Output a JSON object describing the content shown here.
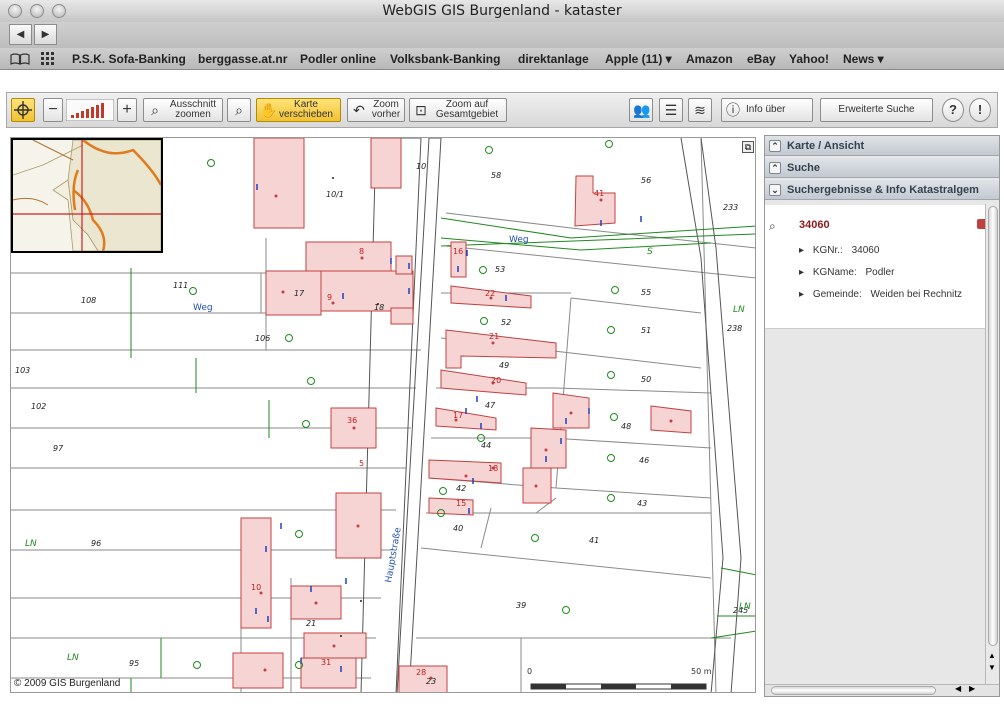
{
  "window": {
    "title": "WebGIS GIS Burgenland - kataster"
  },
  "nav": {
    "back_icon": "◀",
    "forward_icon": "▶"
  },
  "bookmarks": [
    "P.S.K. Sofa-Banking",
    "berggasse.at.nr",
    "Podler online",
    "Volksbank-Banking",
    "direktanlage",
    "Apple (11) ▾",
    "Amazon",
    "eBay",
    "Yahoo!",
    "News ▾"
  ],
  "toolbar": {
    "zoom_out": "−",
    "zoom_in": "+",
    "ausschnitt_line1": "Ausschnitt",
    "ausschnitt_line2": "zoomen",
    "karte_line1": "Karte",
    "karte_line2": "verschieben",
    "zoom_vorher_line1": "Zoom",
    "zoom_vorher_line2": "vorher",
    "zoom_auf_line1": "Zoom auf",
    "zoom_auf_line2": "Gesamtgebiet",
    "info_ueber": "Info über",
    "erweiterte_suche": "Erweiterte Suche",
    "help_icon": "?",
    "info_icon": "!"
  },
  "sidebar": {
    "section_karte": "Karte / Ansicht",
    "section_suche": "Suche",
    "section_ergebnisse": "Suchergebnisse & Info Katastralgem",
    "result_id": "34060",
    "kgnr_label": "KGNr.:",
    "kgnr_value": "34060",
    "kgname_label": "KGName:",
    "kgname_value": "Podler",
    "gemeinde_label": "Gemeinde:",
    "gemeinde_value": "Weiden bei Rechnitz"
  },
  "map": {
    "copyright": "© 2009 GIS Burgenland",
    "scale_start": "0",
    "scale_end": "50 m",
    "street_label": "Hauptstraße",
    "path_labels": [
      "Weg",
      "Weg"
    ],
    "landuse_labels": [
      "LN",
      "LN",
      "LN",
      "LN",
      "S"
    ],
    "parcel_numbers": [
      "10/1",
      "58",
      "56",
      "233",
      "111",
      "108",
      "17",
      "18",
      "53",
      "55",
      "52",
      "51",
      "106",
      "238",
      "103",
      "49",
      "50",
      "102",
      "47",
      "48",
      "97",
      "44",
      "46",
      "42",
      "43",
      "96",
      "40",
      "41",
      "245",
      "39",
      "21",
      "95",
      "23",
      "10"
    ],
    "house_numbers": [
      "41",
      "8",
      "16",
      "9",
      "22",
      "21",
      "36",
      "20",
      "17",
      "18",
      "15",
      "10",
      "31",
      "28",
      "5"
    ]
  },
  "colors": {
    "building_fill": "#f6d4d4",
    "building_stroke": "#c14040",
    "parcel_line": "#7d7d7d",
    "vegetation": "#1e8a1e",
    "boundary": "#e08020",
    "water": "#3060c0",
    "accent": "#f1c232"
  }
}
